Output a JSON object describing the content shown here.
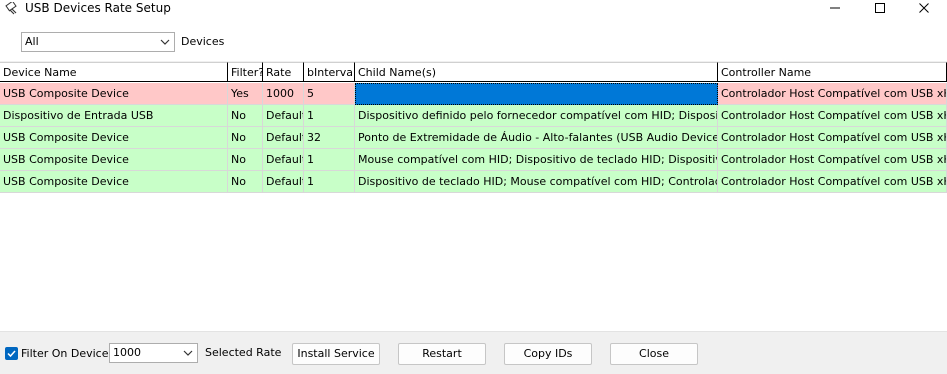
{
  "window": {
    "title": "USB Devices Rate Setup",
    "icons": {
      "app": "usb-plug-icon",
      "minimize": "minimize-icon",
      "maximize": "maximize-icon",
      "close": "close-icon"
    }
  },
  "filter": {
    "device_select_value": "All",
    "device_label": "Devices"
  },
  "table": {
    "columns": [
      "Device Name",
      "Filter?",
      "Rate",
      "bInterval",
      "Child Name(s)",
      "Controller Name"
    ],
    "rows": [
      {
        "device": "USB Composite Device",
        "filter": "Yes",
        "rate": "1000",
        "binterval": "5",
        "child": "",
        "controller": "Controlador Host Compatível com USB xHCI - A",
        "status": "selected"
      },
      {
        "device": "Dispositivo de Entrada USB",
        "filter": "No",
        "rate": "Default",
        "binterval": "1",
        "child": "Dispositivo definido pelo fornecedor compatível com HID; Dispositivo definic",
        "controller": "Controlador Host Compatível com USB xHCI - A",
        "status": "normal"
      },
      {
        "device": "USB Composite Device",
        "filter": "No",
        "rate": "Default",
        "binterval": "32",
        "child": "Ponto de Extremidade de Áudio - Alto-falantes (USB Audio Device); Ponto de",
        "controller": "Controlador Host Compatível com USB xHCI - A",
        "status": "normal"
      },
      {
        "device": "USB Composite Device",
        "filter": "No",
        "rate": "Default",
        "binterval": "1",
        "child": "Mouse compatível com HID; Dispositivo de teclado HID; Dispositivo de con",
        "controller": "Controlador Host Compatível com USB xHCI - A",
        "status": "normal"
      },
      {
        "device": "USB Composite Device",
        "filter": "No",
        "rate": "Default",
        "binterval": "1",
        "child": "Dispositivo de teclado HID; Mouse compatível com HID; Controlador de sist",
        "controller": "Controlador Host Compatível com USB xHCI - A",
        "status": "normal"
      }
    ],
    "colors": {
      "selected_row": "#ffc8c8",
      "normal_row": "#c8ffc8",
      "selected_cell": "#0078d7"
    }
  },
  "footer": {
    "filter_checkbox_label": "Filter On Device",
    "filter_checked": true,
    "rate_select_value": "1000",
    "rate_label": "Selected Rate",
    "install_button": "Install Service",
    "restart_button": "Restart",
    "copy_button": "Copy IDs",
    "close_button": "Close"
  }
}
